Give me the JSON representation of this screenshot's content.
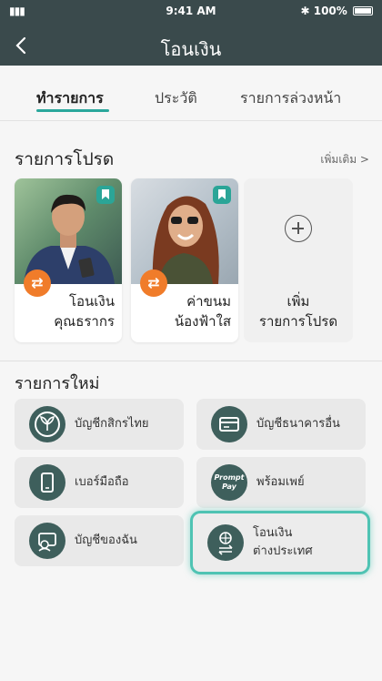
{
  "status_bar": {
    "signal": "▮▮▮",
    "time": "9:41 AM",
    "bluetooth": "✱",
    "battery": "100%"
  },
  "header": {
    "title": "โอนเงิน",
    "back_icon": "chevron-left-icon"
  },
  "tabs": [
    {
      "label": "ทำรายการ",
      "active": true
    },
    {
      "label": "ประวัติ",
      "active": false
    },
    {
      "label": "รายการล่วงหน้า",
      "active": false
    }
  ],
  "favorites": {
    "title": "รายการโปรด",
    "more_link": "เพิ่มเติม >",
    "items": [
      {
        "line1": "โอนเงิน",
        "line2": "คุณธรากร"
      },
      {
        "line1": "ค่าขนม",
        "line2": "น้องฟ้าใส"
      }
    ],
    "add": {
      "line1": "เพิ่ม",
      "line2": "รายการโปรด"
    }
  },
  "new_transactions": {
    "title": "รายการใหม่",
    "items": [
      {
        "label": "บัญชีกสิกรไทย",
        "icon": "kbank-logo-icon"
      },
      {
        "label": "บัญชีธนาคารอื่น",
        "icon": "bank-card-icon"
      },
      {
        "label": "เบอร์มือถือ",
        "icon": "mobile-phone-icon"
      },
      {
        "label": "พร้อมเพย์",
        "icon": "promptpay-icon",
        "icon_text": "Prompt Pay"
      },
      {
        "label": "บัญชีของฉัน",
        "icon": "my-account-icon"
      },
      {
        "label_line1": "โอนเงิน",
        "label_line2": "ต่างประเทศ",
        "icon": "globe-transfer-icon",
        "highlighted": true
      }
    ]
  },
  "colors": {
    "header_bg": "#3a4a4c",
    "accent": "#2aa79c",
    "swap_badge": "#f07c2a",
    "icon_bg": "#3e5f5c",
    "highlight": "#4fc3b3"
  }
}
